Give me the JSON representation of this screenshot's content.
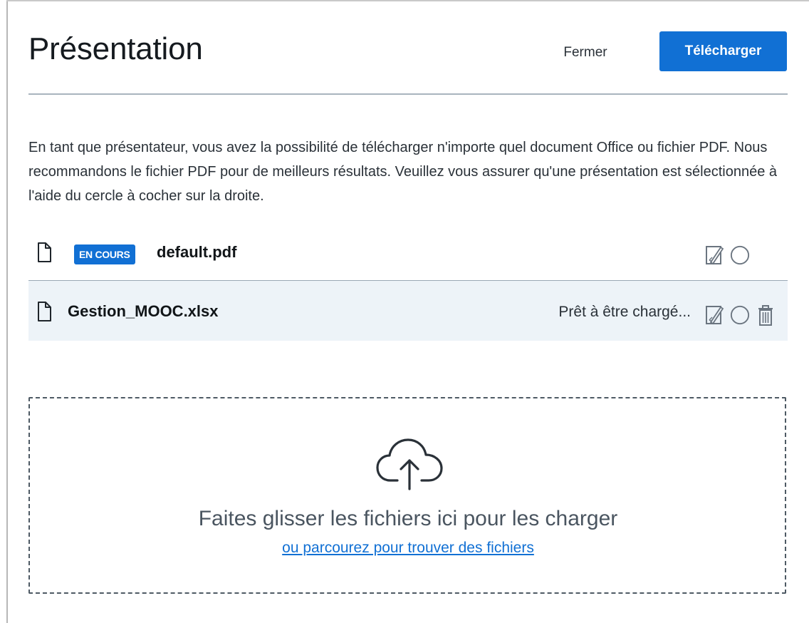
{
  "header": {
    "title": "Présentation",
    "close_label": "Fermer",
    "upload_label": "Télécharger"
  },
  "description": "En tant que présentateur, vous avez la possibilité de télécharger n'importe quel document Office ou fichier PDF. Nous recommandons le fichier PDF pour de meilleurs résultats. Veuillez vous assurer qu'une présentation est sélectionnée à l'aide du cercle à cocher sur la droite.",
  "files": [
    {
      "badge": "EN COURS",
      "name": "default.pdf",
      "status": "",
      "icons": [
        "file-icon",
        "edit-download-icon",
        "radio-circle-icon"
      ]
    },
    {
      "badge": "",
      "name": "Gestion_MOOC.xlsx",
      "status": "Prêt à être chargé...",
      "icons": [
        "file-icon",
        "edit-download-icon",
        "radio-circle-icon",
        "trash-icon"
      ]
    }
  ],
  "dropzone": {
    "icon": "cloud-upload-icon",
    "text": "Faites glisser les fichiers ici pour les charger",
    "browse_link": "ou parcourez pour trouver des fichiers"
  },
  "colors": {
    "accent": "#1170d4",
    "selected_row_bg": "#edf3f8",
    "text": "#2a3138"
  }
}
